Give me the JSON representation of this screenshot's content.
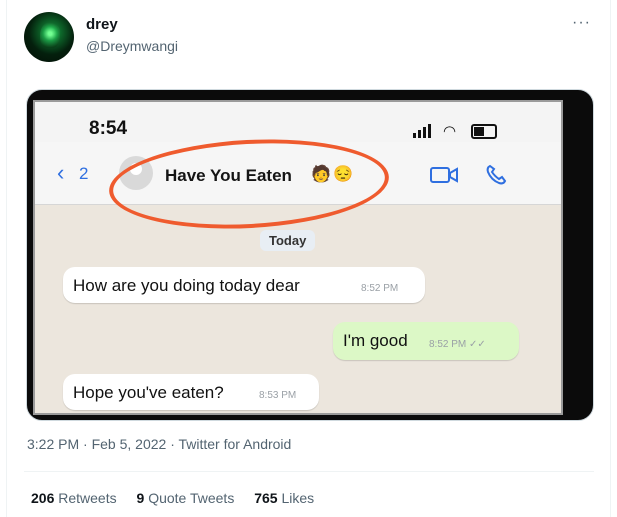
{
  "tweet": {
    "author_name": "drey",
    "author_handle": "@Dreymwangi",
    "more_label": "···",
    "meta": "3:22 PM · Feb 5, 2022 · Twitter for Android",
    "stats": [
      {
        "count": "206",
        "label": "Retweets"
      },
      {
        "count": "9",
        "label": "Quote Tweets"
      },
      {
        "count": "765",
        "label": "Likes"
      }
    ]
  },
  "screenshot": {
    "status_time": "8:54",
    "back_count": "2",
    "chat_title": "Have You Eaten",
    "title_emojis": [
      "🧑",
      "😔"
    ],
    "date_label": "Today",
    "messages": [
      {
        "text": "How are you doing today dear",
        "time": "8:52 PM",
        "side": "in"
      },
      {
        "text": "I'm good",
        "time": "8:52 PM ✓✓",
        "side": "out"
      },
      {
        "text": "Hope you've eaten?",
        "time": "8:53 PM",
        "side": "in"
      }
    ],
    "highlight_color": "#ef5b2e"
  }
}
